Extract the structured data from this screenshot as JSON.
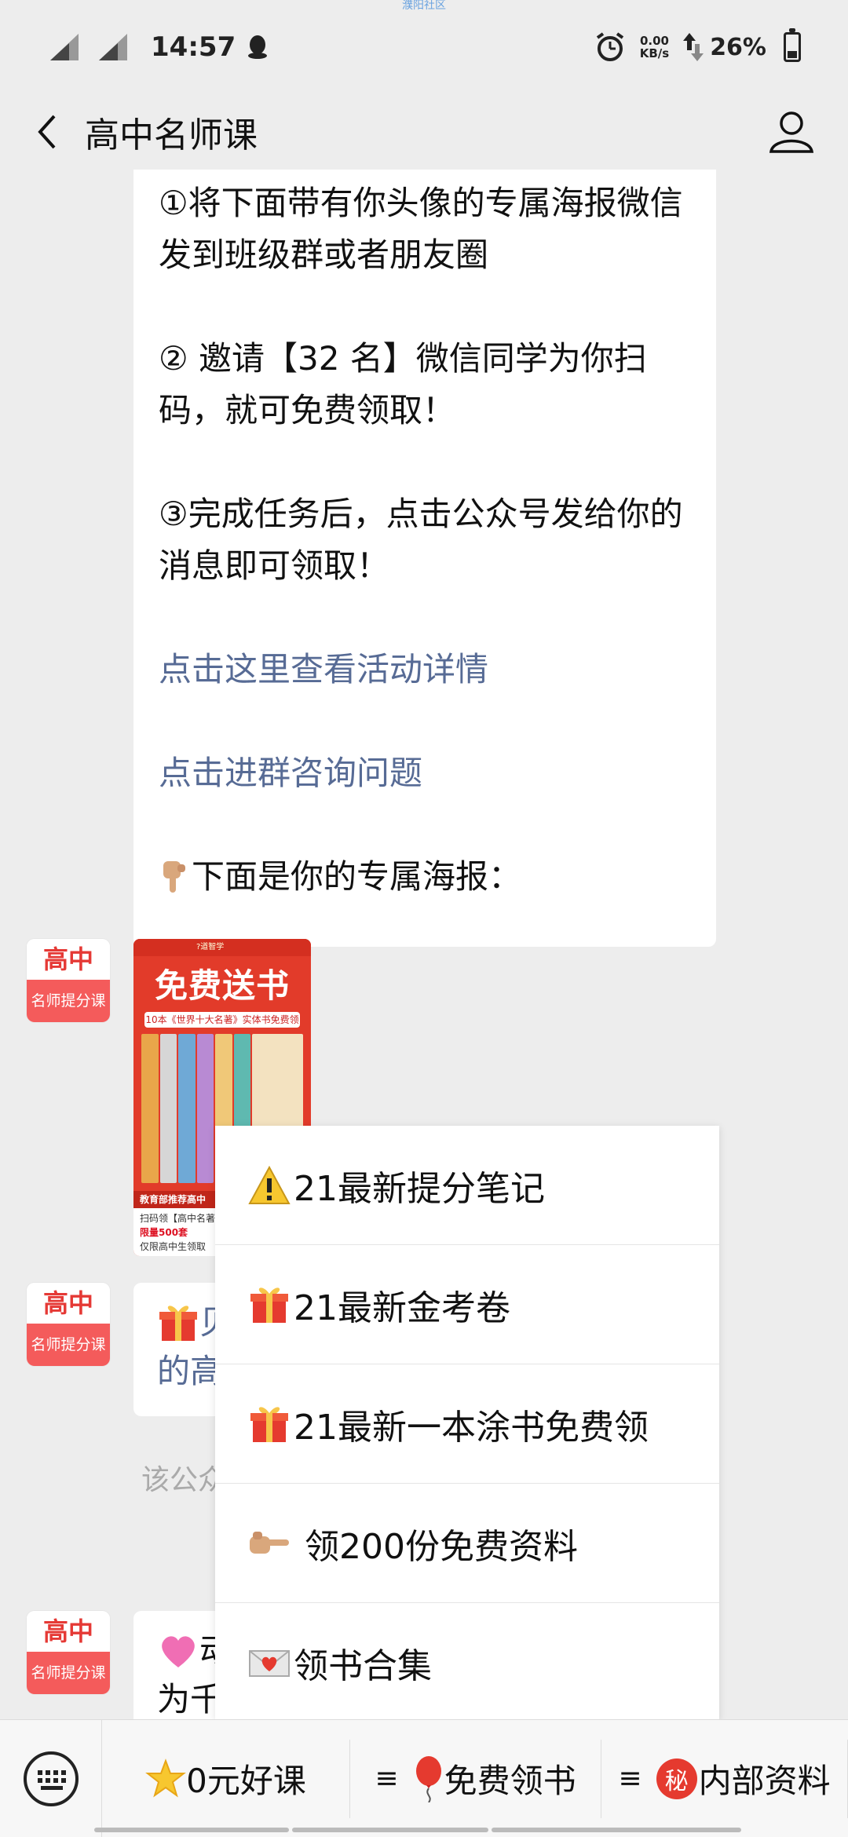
{
  "watermark": "濮阳社区",
  "status_bar": {
    "time": "14:57",
    "net_speed_value": "0.00",
    "net_speed_unit": "KB/s",
    "battery": "26%"
  },
  "nav": {
    "title": "高中名师课"
  },
  "messages": {
    "main_paragraphs": [
      "①将下面带有你头像的专属海报微信发到班级群或者朋友圈",
      "② 邀请【32 名】微信同学为你扫码，就可免费领取！",
      "③完成任务后，点击公众号发给你的消息即可领取！"
    ],
    "link_details": "点击这里查看活动详情",
    "link_group": "点击进群咨询问题",
    "poster_intro": "下面是你的专属海报：",
    "avatar_top": "高中",
    "avatar_bottom": "名师提分课",
    "poster": {
      "brand": "?道智学",
      "title": "免费送书",
      "subtitle": "10本《世界十大名著》实体书免费领",
      "footer_1": "教育部推荐高中",
      "footer_2": "扫码领【高中名著】",
      "footer_3": "限量500套",
      "footer_4": "仅限高中生领取"
    },
    "bubble2_text_a": "贝",
    "bubble2_text_b": "的高",
    "sys_tip": "该公众",
    "bubble3_text_a": "动",
    "bubble3_text_b": "为千"
  },
  "menu": {
    "items": [
      {
        "label": "21最新提分笔记",
        "icon": "warning-icon"
      },
      {
        "label": "21最新金考卷",
        "icon": "gift-icon"
      },
      {
        "label": "21最新一本涂书免费领",
        "icon": "gift-icon"
      },
      {
        "label": " 领200份免费资料",
        "icon": "pointing-hand-icon"
      },
      {
        "label": "领书合集",
        "icon": "love-letter-icon"
      }
    ]
  },
  "bottom_bar": {
    "tab1": "0元好课",
    "tab2": "免费领书",
    "tab3": "内部资料",
    "tab3_badge": "秘",
    "tab_prefix": "≡"
  },
  "colors": {
    "link": "#576b95",
    "avatar_red": "#f45b5b",
    "poster_red": "#e23b2a",
    "background": "#ededed"
  }
}
